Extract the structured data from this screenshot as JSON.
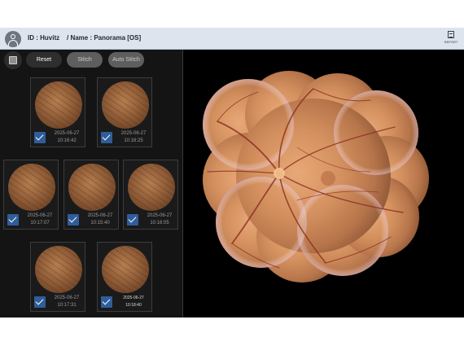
{
  "header": {
    "title": "ID : Huvitz    / Name : Panorama [OS]",
    "report_label": "REPORT"
  },
  "toolbar": {
    "reset_label": "Reset",
    "stitch_label": "Stitch",
    "auto_stitch_label": "Auto Stitch"
  },
  "thumbnails": [
    {
      "date": "2025-06-27",
      "time": "10:16:42",
      "checked": true
    },
    {
      "date": "2025-06-27",
      "time": "10:16:25",
      "checked": true
    },
    {
      "date": "2025-06-27",
      "time": "10:17:07",
      "checked": true
    },
    {
      "date": "2025-06-27",
      "time": "10:15:40",
      "checked": true
    },
    {
      "date": "2025-06-27",
      "time": "10:16:05",
      "checked": true
    },
    {
      "date": "2025-06-27",
      "time": "10:17:31",
      "checked": true
    },
    {
      "date": "2025-06-27",
      "time": "10:18:40",
      "checked": true,
      "selected": true
    }
  ],
  "colors": {
    "header_bg": "#dde4ee",
    "checkbox_blue": "#2f5d9a",
    "panel_bg": "#141414"
  }
}
